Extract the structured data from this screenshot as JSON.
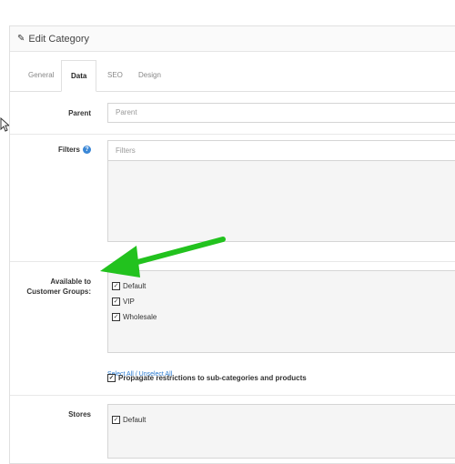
{
  "panel": {
    "title": "Edit Category"
  },
  "tabs": [
    {
      "label": "General",
      "active": false
    },
    {
      "label": "Data",
      "active": true
    },
    {
      "label": "SEO",
      "active": false
    },
    {
      "label": "Design",
      "active": false
    }
  ],
  "parent": {
    "label": "Parent",
    "placeholder": "Parent"
  },
  "filters": {
    "label": "Filters",
    "placeholder": "Filters"
  },
  "customer_groups": {
    "label_line1": "Available to",
    "label_line2": "Customer Groups:",
    "options": [
      {
        "label": "Default",
        "checked": true
      },
      {
        "label": "VIP",
        "checked": true
      },
      {
        "label": "Wholesale",
        "checked": true
      }
    ],
    "select_all": "Select All",
    "separator": " / ",
    "unselect_all": "Unselect All",
    "propagate": {
      "label": "Propagate restrictions to sub-categories and products",
      "checked": true
    }
  },
  "stores": {
    "label": "Stores",
    "options": [
      {
        "label": "Default",
        "checked": true
      }
    ]
  },
  "colors": {
    "accent": "#2a7bd1",
    "arrow": "#22c21e",
    "help": "#3a87d6"
  },
  "icons": {
    "edit": "pencil-icon",
    "help": "question-circle-icon",
    "cursor": "mouse-pointer-icon",
    "annotation": "green-arrow-annotation"
  }
}
